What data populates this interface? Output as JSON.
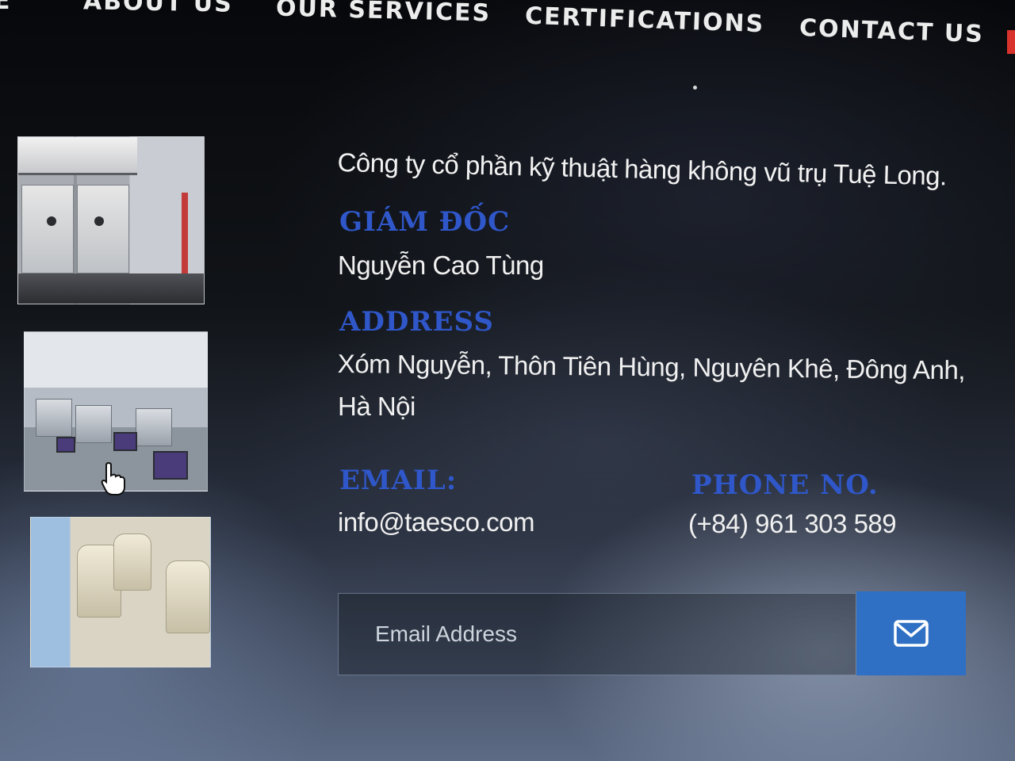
{
  "nav": {
    "items": [
      {
        "label": "E"
      },
      {
        "label": "ABOUT US"
      },
      {
        "label": "OUR SERVICES"
      },
      {
        "label": "CERTIFICATIONS"
      },
      {
        "label": "CONTACT US"
      }
    ]
  },
  "contact": {
    "company": "Công ty cổ phần kỹ thuật hàng không vũ trụ Tuệ Long.",
    "director_label": "GIÁM ĐỐC",
    "director_name": "Nguyễn Cao Tùng",
    "address_label": "ADDRESS",
    "address_line1": "Xóm Nguyễn, Thôn Tiên Hùng, Nguyên Khê, Đông Anh,",
    "address_line2": "Hà Nội",
    "email_label": "EMAIL:",
    "email_value": "info@taesco.com",
    "phone_label": "PHONE NO.",
    "phone_value": "(+84) 961 303 589"
  },
  "subscribe": {
    "placeholder": "Email Address",
    "button_icon": "envelope-icon"
  },
  "colors": {
    "label_blue": "#2f57c9",
    "button_blue": "#2f6fc4",
    "nav_accent_red": "#d7332c"
  }
}
